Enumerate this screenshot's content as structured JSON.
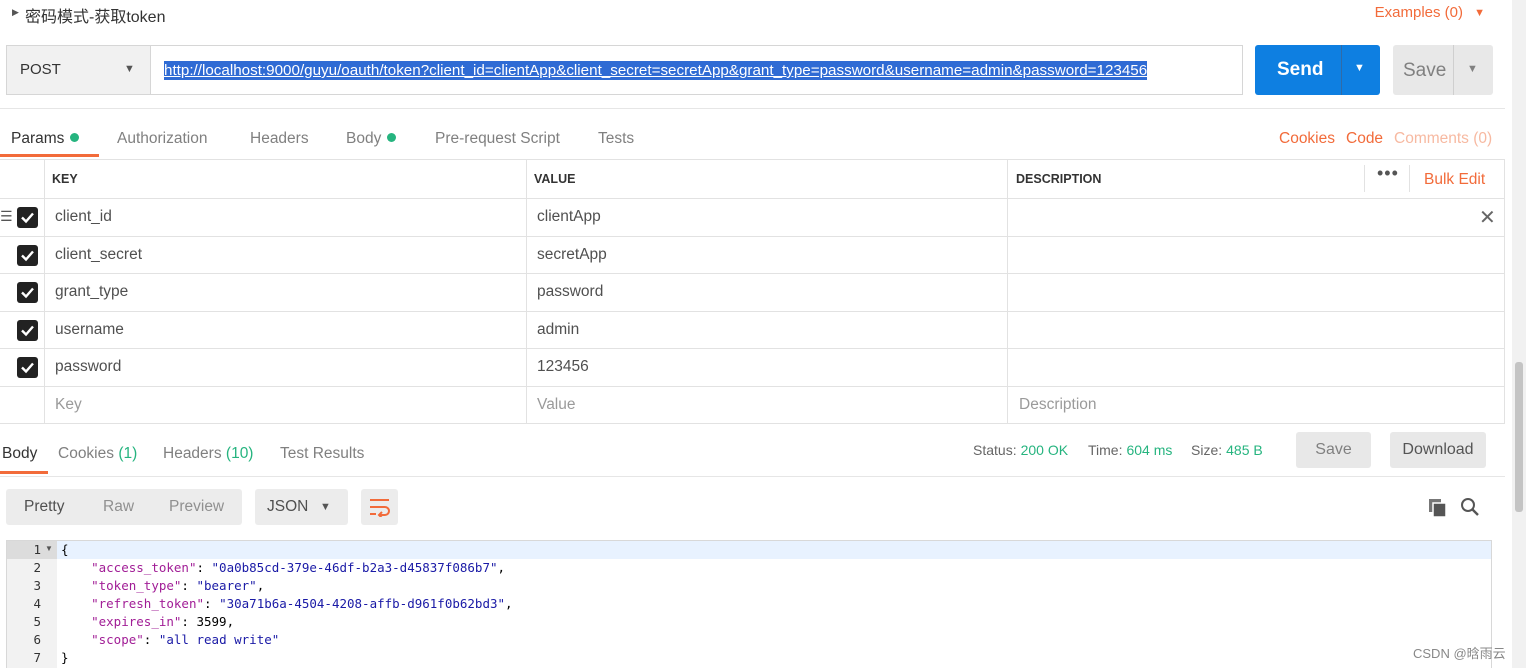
{
  "request": {
    "title": "密码模式-获取token",
    "examples_label": "Examples (0)",
    "method": "POST",
    "url": "http://localhost:9000/guyu/oauth/token?client_id=clientApp&client_secret=secretApp&grant_type=password&username=admin&password=123456",
    "send_label": "Send",
    "save_label": "Save"
  },
  "request_tabs": {
    "params": "Params",
    "authorization": "Authorization",
    "headers": "Headers",
    "body": "Body",
    "prerequest": "Pre-request Script",
    "tests": "Tests",
    "cookies": "Cookies",
    "code": "Code",
    "comments": "Comments (0)"
  },
  "params_table": {
    "headers": {
      "key": "KEY",
      "value": "VALUE",
      "description": "DESCRIPTION"
    },
    "bulk_edit": "Bulk Edit",
    "rows": [
      {
        "key": "client_id",
        "value": "clientApp",
        "checked": true
      },
      {
        "key": "client_secret",
        "value": "secretApp",
        "checked": true
      },
      {
        "key": "grant_type",
        "value": "password",
        "checked": true
      },
      {
        "key": "username",
        "value": "admin",
        "checked": true
      },
      {
        "key": "password",
        "value": "123456",
        "checked": true
      }
    ],
    "placeholders": {
      "key": "Key",
      "value": "Value",
      "description": "Description"
    }
  },
  "response": {
    "tabs": {
      "body": "Body",
      "cookies": "Cookies",
      "cookies_count": "(1)",
      "headers": "Headers",
      "headers_count": "(10)",
      "tests": "Test Results"
    },
    "status_label": "Status:",
    "status": "200 OK",
    "time_label": "Time:",
    "time": "604 ms",
    "size_label": "Size:",
    "size": "485 B",
    "save_label": "Save",
    "download_label": "Download",
    "view_modes": [
      "Pretty",
      "Raw",
      "Preview"
    ],
    "format": "JSON",
    "lines": [
      "1",
      "2",
      "3",
      "4",
      "5",
      "6",
      "7"
    ],
    "json": {
      "open": "{",
      "access_token_key": "\"access_token\"",
      "access_token_val": "\"0a0b85cd-379e-46df-b2a3-d45837f086b7\"",
      "token_type_key": "\"token_type\"",
      "token_type_val": "\"bearer\"",
      "refresh_token_key": "\"refresh_token\"",
      "refresh_token_val": "\"30a71b6a-4504-4208-affb-d961f0b62bd3\"",
      "expires_in_key": "\"expires_in\"",
      "expires_in_val": "3599",
      "scope_key": "\"scope\"",
      "scope_val": "\"all read write\"",
      "close": "}"
    }
  },
  "watermark": "CSDN @晗雨云",
  "colors": {
    "accent": "#f26b3a",
    "primary": "#0e7fe1",
    "success": "#26b47f"
  }
}
